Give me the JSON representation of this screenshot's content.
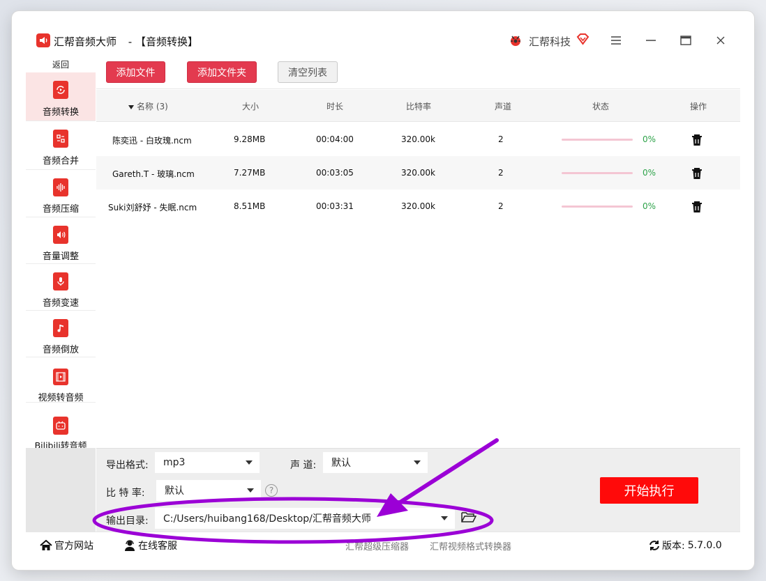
{
  "window": {
    "app_name": "汇帮音频大师",
    "separator": "-",
    "module_title": "【音频转换】",
    "brand": "汇帮科技"
  },
  "sidebar": {
    "back": "返回",
    "items": [
      {
        "label": "音频转换",
        "icon": "audio-convert-icon",
        "active": true
      },
      {
        "label": "音频合并",
        "icon": "audio-merge-icon",
        "active": false
      },
      {
        "label": "音频压缩",
        "icon": "audio-compress-icon",
        "active": false
      },
      {
        "label": "音量调整",
        "icon": "volume-adjust-icon",
        "active": false
      },
      {
        "label": "音频变速",
        "icon": "audio-speed-icon",
        "active": false
      },
      {
        "label": "音频倒放",
        "icon": "audio-reverse-icon",
        "active": false
      },
      {
        "label": "视频转音频",
        "icon": "video-to-audio-icon",
        "active": false
      },
      {
        "label": "Bilibili转音频",
        "icon": "bilibili-icon",
        "active": false
      }
    ]
  },
  "toolbar": {
    "add_file": "添加文件",
    "add_folder": "添加文件夹",
    "clear_list": "清空列表"
  },
  "table": {
    "headers": {
      "name": "名称 (3)",
      "size": "大小",
      "duration": "时长",
      "bitrate": "比特率",
      "channels": "声道",
      "status": "状态",
      "actions": "操作"
    },
    "rows": [
      {
        "name": "陈奕迅 - 白玫瑰.ncm",
        "size": "9.28MB",
        "duration": "00:04:00",
        "bitrate": "320.00k",
        "channels": "2",
        "progress": 0,
        "progress_label": "0%"
      },
      {
        "name": "Gareth.T - 玻璃.ncm",
        "size": "7.27MB",
        "duration": "00:03:05",
        "bitrate": "320.00k",
        "channels": "2",
        "progress": 0,
        "progress_label": "0%"
      },
      {
        "name": "Suki刘舒妤 - 失眠.ncm",
        "size": "8.51MB",
        "duration": "00:03:31",
        "bitrate": "320.00k",
        "channels": "2",
        "progress": 0,
        "progress_label": "0%"
      }
    ]
  },
  "settings": {
    "format_label": "导出格式:",
    "format_value": "mp3",
    "channel_label": "声 道:",
    "channel_value": "默认",
    "bitrate_label": "比 特 率:",
    "bitrate_value": "默认",
    "help": "?",
    "output_label": "输出目录:",
    "output_value": "C:/Users/huibang168/Desktop/汇帮音频大师",
    "start": "开始执行"
  },
  "footer": {
    "website": "官方网站",
    "support": "在线客服",
    "link1": "汇帮超级压缩器",
    "link2": "汇帮视频格式转换器",
    "version_label": "版本:",
    "version": "5.7.0.0"
  },
  "colors": {
    "accent_red": "#e33a4f",
    "start_red": "#ff0a0a",
    "progress_track": "#f4c6d3",
    "percent_green": "#2ea34a",
    "annotation_purple": "#9b00d6"
  }
}
